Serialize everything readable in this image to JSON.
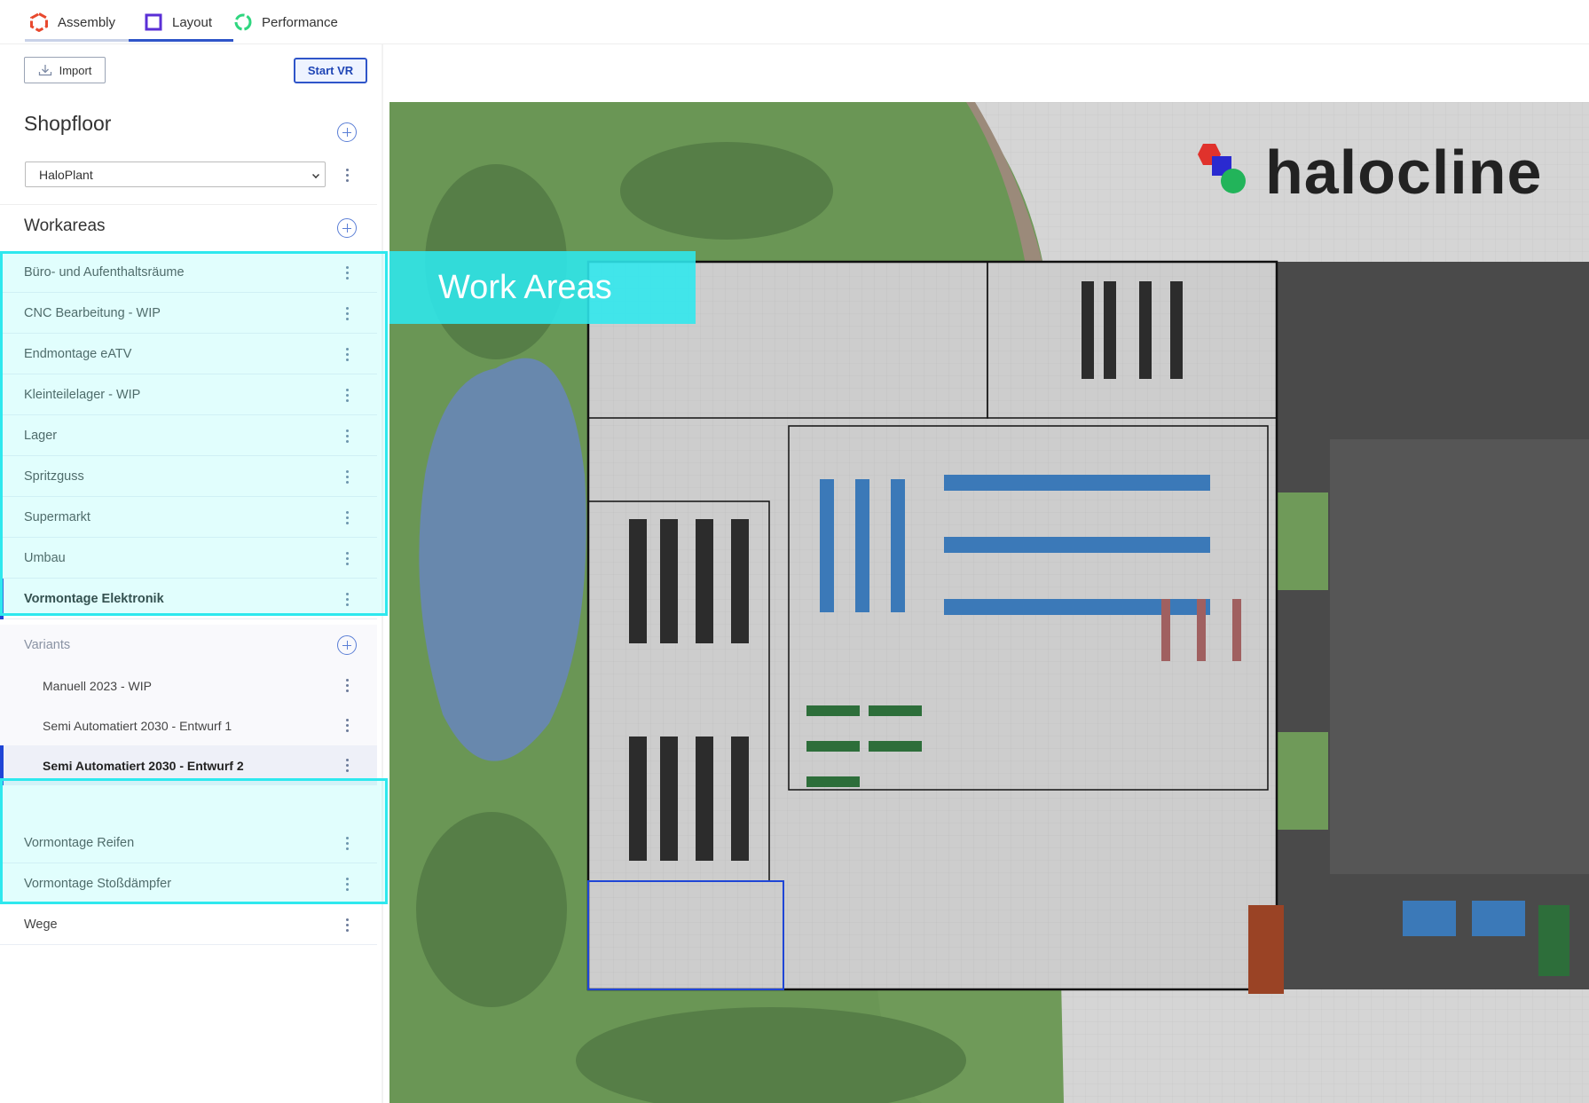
{
  "tabs": [
    {
      "label": "Assembly",
      "color": "#e8492e"
    },
    {
      "label": "Layout",
      "color": "#5a2fd6",
      "active": true
    },
    {
      "label": "Performance",
      "color": "#2fd67f"
    }
  ],
  "toolbar": {
    "import_label": "Import",
    "vr_label": "Start VR"
  },
  "shopfloor": {
    "title": "Shopfloor",
    "selected": "HaloPlant"
  },
  "workareas": {
    "title": "Workareas",
    "items": [
      {
        "label": "Büro- und Aufenthaltsräume"
      },
      {
        "label": "CNC Bearbeitung - WIP"
      },
      {
        "label": "Endmontage eATV"
      },
      {
        "label": "Kleinteilelager - WIP"
      },
      {
        "label": "Lager"
      },
      {
        "label": "Spritzguss"
      },
      {
        "label": "Supermarkt"
      },
      {
        "label": "Umbau"
      },
      {
        "label": "Vormontage Elektronik",
        "active": true
      }
    ],
    "after": [
      {
        "label": "Vormontage Reifen"
      },
      {
        "label": "Vormontage Stoßdämpfer"
      },
      {
        "label": "Wege"
      }
    ]
  },
  "variants": {
    "title": "Variants",
    "items": [
      {
        "label": "Manuell 2023 - WIP"
      },
      {
        "label": "Semi Automatiert 2030 - Entwurf 1"
      },
      {
        "label": "Semi Automatiert 2030 - Entwurf 2",
        "active": true
      }
    ]
  },
  "overlay": {
    "label": "Work Areas"
  },
  "logo": {
    "text": "halocline"
  },
  "colors": {
    "accent": "#1f45d6",
    "highlight": "#2ee8ee",
    "grass": "#6f9a59",
    "water": "#6888ad",
    "floor": "#c9c9c9"
  }
}
